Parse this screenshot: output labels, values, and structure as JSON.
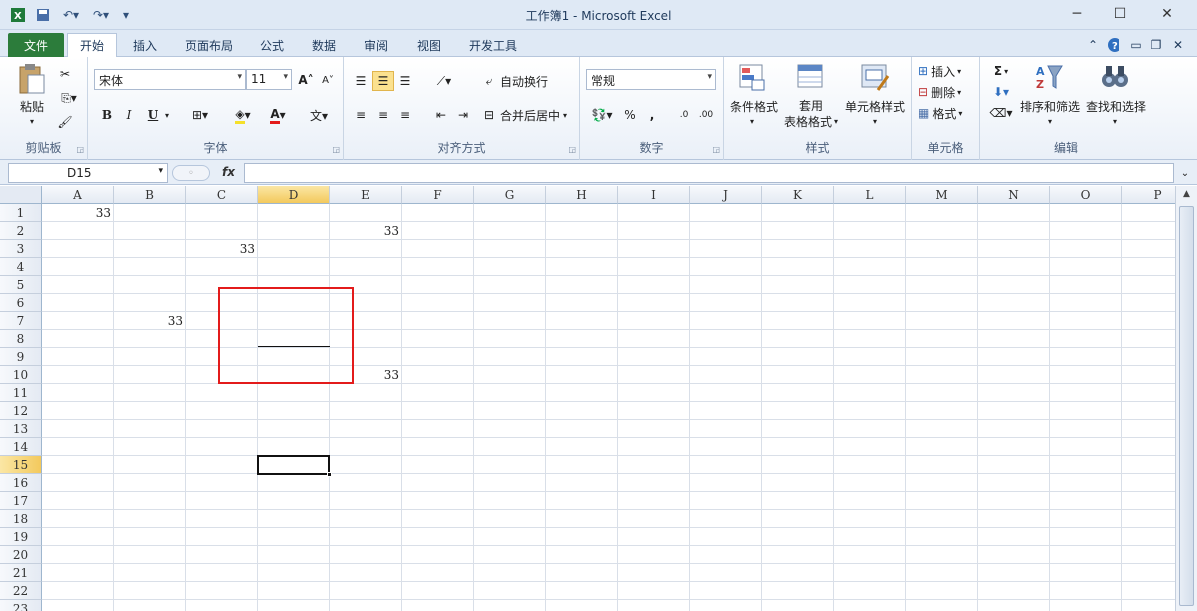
{
  "window": {
    "title": "工作簿1 - Microsoft Excel"
  },
  "tabs": [
    "文件",
    "开始",
    "插入",
    "页面布局",
    "公式",
    "数据",
    "审阅",
    "视图",
    "开发工具"
  ],
  "ribbon": {
    "clipboard": {
      "label": "剪贴板",
      "paste": "粘贴"
    },
    "font": {
      "label": "字体",
      "name": "宋体",
      "size": "11",
      "bold": "B",
      "italic": "I",
      "underline": "U"
    },
    "alignment": {
      "label": "对齐方式",
      "wrap": "自动换行",
      "merge": "合并后居中"
    },
    "number": {
      "label": "数字",
      "format": "常规",
      "percent": "%",
      "comma": ","
    },
    "styles": {
      "label": "样式",
      "conditional": "条件格式",
      "table_1": "套用",
      "table_2": "表格格式",
      "cell_styles": "单元格样式"
    },
    "cells": {
      "label": "单元格",
      "insert": "插入",
      "delete": "删除",
      "format": "格式"
    },
    "editing": {
      "label": "编辑",
      "sum": "Σ",
      "sort": "排序和筛选",
      "find": "查找和选择"
    }
  },
  "formula_bar": {
    "name_box": "D15",
    "fx": "fx",
    "content": ""
  },
  "sheet": {
    "columns": [
      "A",
      "B",
      "C",
      "D",
      "E",
      "F",
      "G",
      "H",
      "I",
      "J",
      "K",
      "L",
      "M",
      "N",
      "O",
      "P"
    ],
    "rows": [
      "1",
      "2",
      "3",
      "4",
      "5",
      "6",
      "7",
      "8",
      "9",
      "10",
      "11",
      "12",
      "13",
      "14",
      "15",
      "16",
      "17",
      "18",
      "19",
      "20",
      "21",
      "22",
      "23"
    ],
    "active_cell": "D15",
    "cells": [
      {
        "ref": "A1",
        "value": "33"
      },
      {
        "ref": "E2",
        "value": "33"
      },
      {
        "ref": "C3",
        "value": "33"
      },
      {
        "ref": "B7",
        "value": "33"
      },
      {
        "ref": "E10",
        "value": "33"
      }
    ]
  },
  "colors": {
    "file_tab": "#2c7c3b",
    "annotation": "#e31b1b",
    "selected_header": "#f3c95d"
  }
}
